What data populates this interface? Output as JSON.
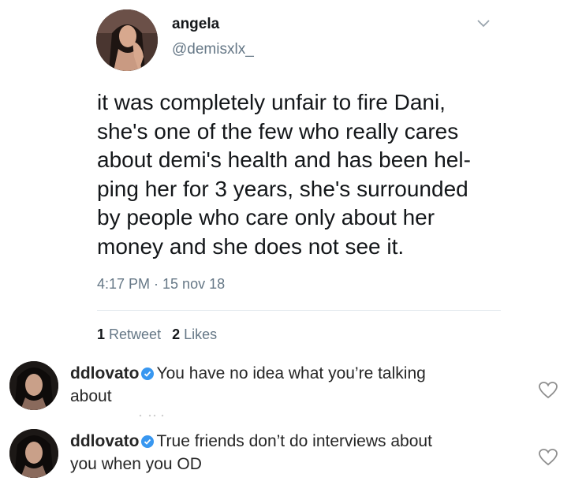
{
  "tweet": {
    "display_name": "angela",
    "handle": "@demisxlx_",
    "text_lines": [
      "it was completely unfair to fire Dani,",
      "she's one of the few who really cares",
      "about demi's health and has been hel-",
      "ping her for 3 years, she's surrounded",
      "by people who care only about her",
      "money and she does not see it."
    ],
    "timestamp": "4:17 PM · 15 nov 18",
    "retweet_count": "1",
    "retweet_label": "Retweet",
    "like_count": "2",
    "like_label": "Likes"
  },
  "comments": [
    {
      "username": "ddlovato",
      "line1": "You have no idea what you’re talking",
      "line2": "about"
    },
    {
      "username": "ddlovato",
      "line1": "True friends don’t do interviews about",
      "line2": "you when you OD"
    }
  ],
  "colors": {
    "text_primary": "#14171a",
    "text_secondary": "#657786",
    "divider": "#e1e8ed",
    "verified_blue": "#3897f0"
  },
  "icons": [
    "chevron-down-icon",
    "verified-badge-icon",
    "heart-icon"
  ]
}
